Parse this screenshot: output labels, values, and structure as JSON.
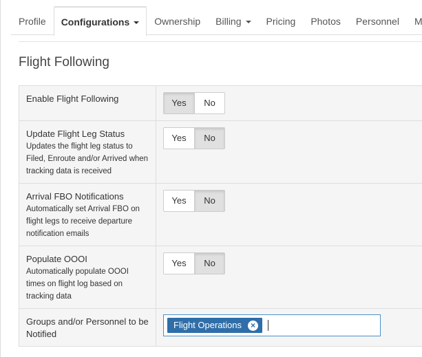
{
  "tabs": [
    {
      "label": "Profile",
      "dropdown": false,
      "active": false
    },
    {
      "label": "Configurations",
      "dropdown": true,
      "active": true
    },
    {
      "label": "Ownership",
      "dropdown": false,
      "active": false
    },
    {
      "label": "Billing",
      "dropdown": true,
      "active": false
    },
    {
      "label": "Pricing",
      "dropdown": false,
      "active": false
    },
    {
      "label": "Photos",
      "dropdown": false,
      "active": false
    },
    {
      "label": "Personnel",
      "dropdown": false,
      "active": false
    },
    {
      "label": "M",
      "dropdown": false,
      "active": false
    }
  ],
  "section": {
    "title": "Flight Following"
  },
  "toggle_labels": {
    "yes": "Yes",
    "no": "No"
  },
  "settings": [
    {
      "label": "Enable Flight Following",
      "description": "",
      "value": "Yes"
    },
    {
      "label": "Update Flight Leg Status",
      "description": "Updates the flight leg status to Filed, Enroute and/or Arrived when tracking data is received",
      "value": "No"
    },
    {
      "label": "Arrival FBO Notifications",
      "description": "Automatically set Arrival FBO on flight legs to receive departure notification emails",
      "value": "No"
    },
    {
      "label": "Populate OOOI",
      "description": "Automatically populate OOOI times on flight log based on tracking data",
      "value": "No"
    }
  ],
  "notify": {
    "label": "Groups and/or Personnel to be Notified",
    "tags": [
      "Flight Operations"
    ],
    "remove_glyph": "×"
  },
  "colors": {
    "accent": "#2f6ea8",
    "focus_border": "#4a90c8"
  }
}
